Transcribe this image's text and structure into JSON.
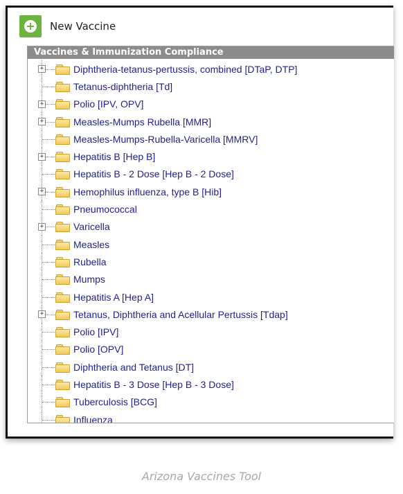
{
  "toolbar": {
    "new_button_label": "New Vaccine"
  },
  "panel": {
    "title": "Vaccines & Immunization Compliance"
  },
  "tree": {
    "items": [
      {
        "label": "Diphtheria-tetanus-pertussis, combined [DTaP, DTP]",
        "expandable": true
      },
      {
        "label": "Tetanus-diphtheria [Td]",
        "expandable": false
      },
      {
        "label": "Polio [IPV, OPV]",
        "expandable": true
      },
      {
        "label": "Measles-Mumps Rubella [MMR]",
        "expandable": true
      },
      {
        "label": "Measles-Mumps-Rubella-Varicella [MMRV]",
        "expandable": false
      },
      {
        "label": "Hepatitis B [Hep B]",
        "expandable": true
      },
      {
        "label": "Hepatitis B - 2 Dose [Hep B - 2 Dose]",
        "expandable": false
      },
      {
        "label": "Hemophilus influenza, type B [Hib]",
        "expandable": true
      },
      {
        "label": "Pneumococcal",
        "expandable": false
      },
      {
        "label": "Varicella",
        "expandable": true
      },
      {
        "label": "Measles",
        "expandable": false
      },
      {
        "label": "Rubella",
        "expandable": false
      },
      {
        "label": "Mumps",
        "expandable": false
      },
      {
        "label": "Hepatitis A [Hep A]",
        "expandable": false
      },
      {
        "label": "Tetanus, Diphtheria and Acellular Pertussis [Tdap]",
        "expandable": true
      },
      {
        "label": "Polio [IPV]",
        "expandable": false
      },
      {
        "label": "Polio [OPV]",
        "expandable": false
      },
      {
        "label": "Diphtheria and Tetanus [DT]",
        "expandable": false
      },
      {
        "label": "Hepatitis B - 3 Dose [Hep B - 3 Dose]",
        "expandable": false
      },
      {
        "label": "Tuberculosis [BCG]",
        "expandable": false
      },
      {
        "label": "Influenza",
        "expandable": false
      }
    ]
  },
  "caption": "Arizona Vaccines Tool",
  "colors": {
    "add_button": "#6db33f",
    "header_bg": "#8c8c8c",
    "link_text": "#1f1f8f",
    "caption_text": "#a8a8a8"
  },
  "icons": {
    "add": "plus-circle-icon",
    "folder": "folder-icon",
    "expand": "expand-plus-icon"
  }
}
